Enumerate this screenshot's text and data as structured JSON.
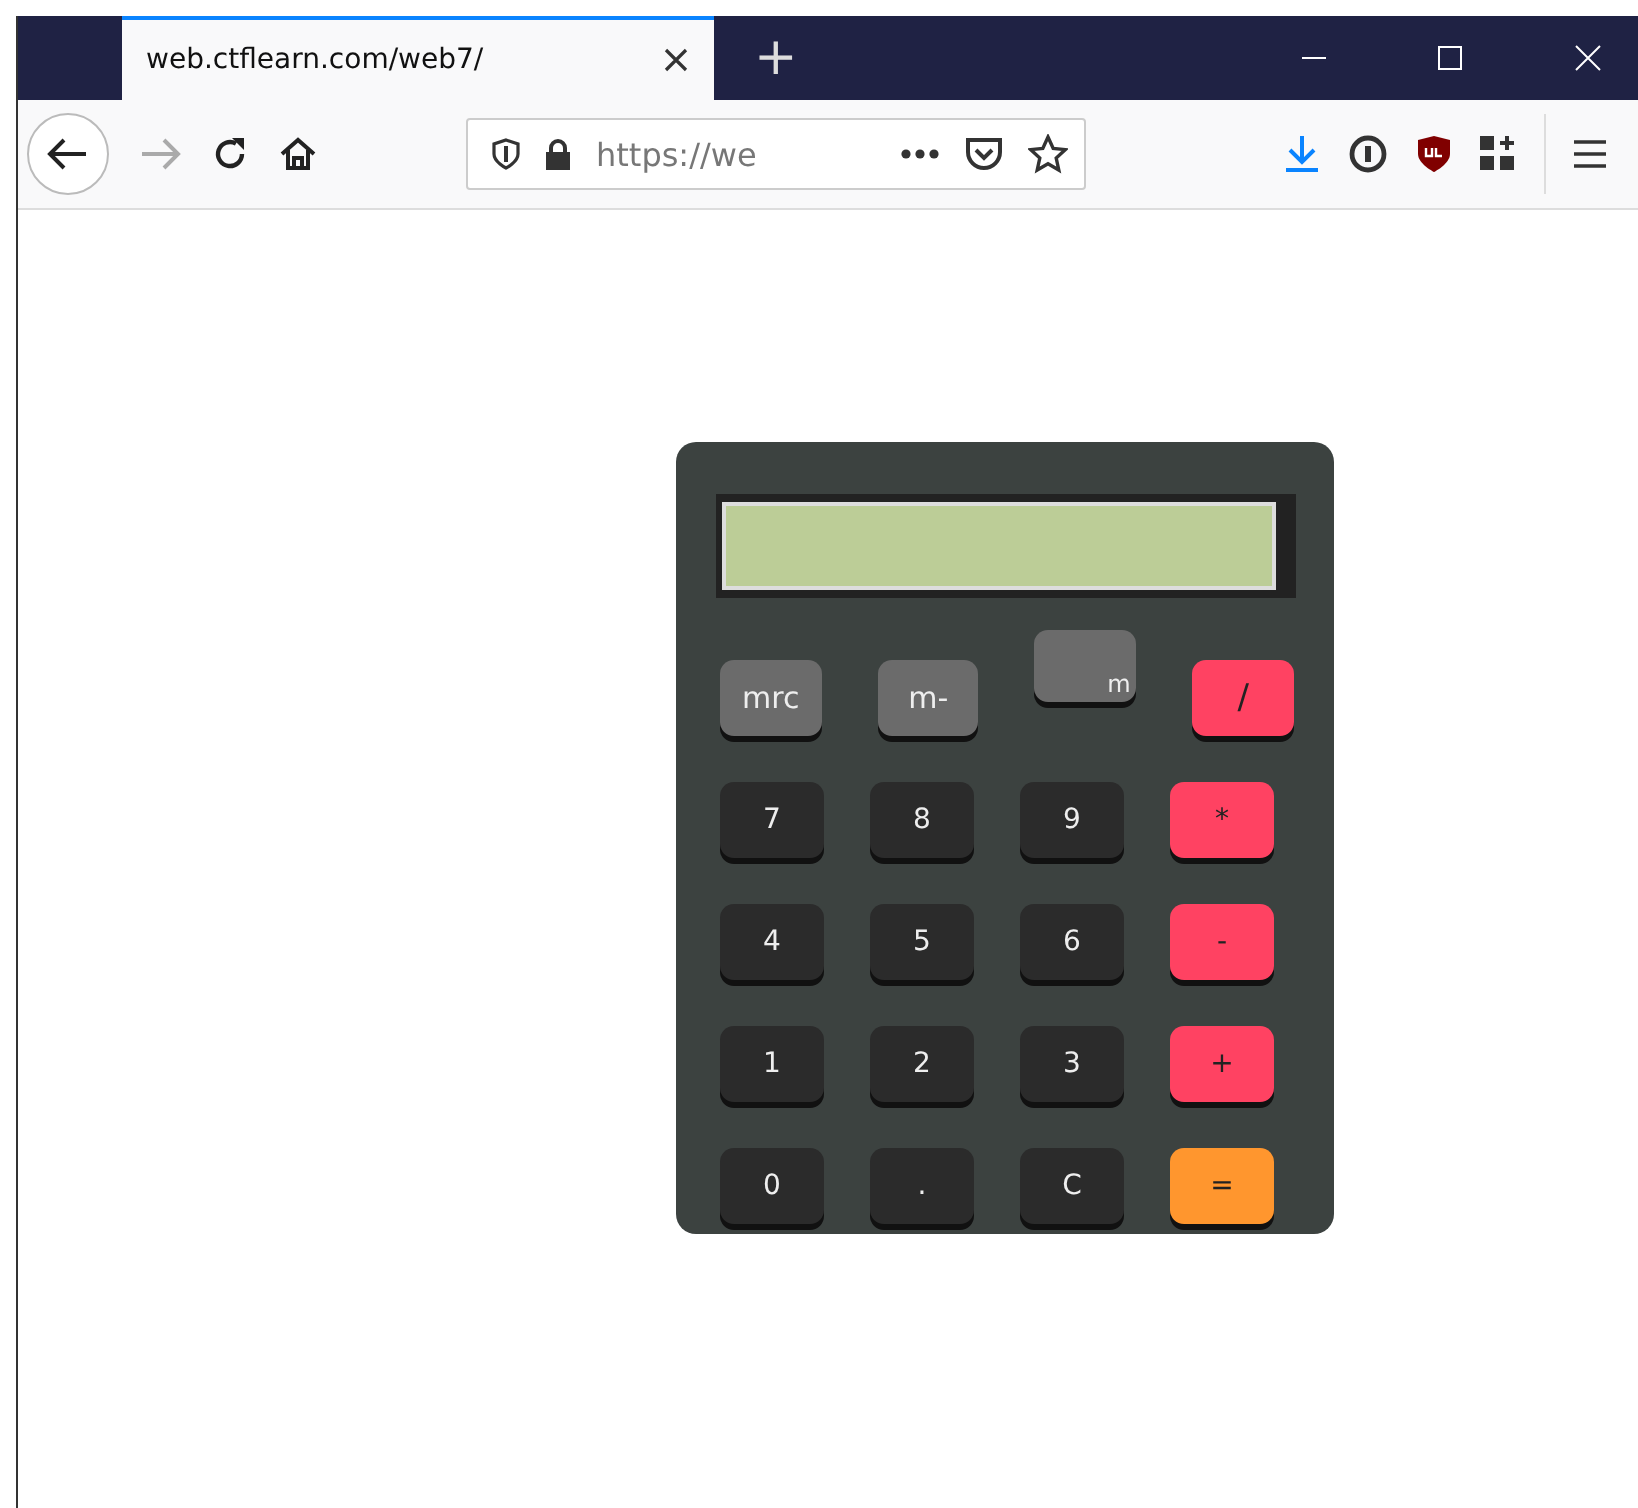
{
  "window": {
    "tab_title": "web.ctflearn.com/web7/",
    "new_tab": "+"
  },
  "toolbar": {
    "url": "https://we"
  },
  "calculator": {
    "rows": [
      [
        {
          "label": "mrc",
          "kind": "memory"
        },
        {
          "label": "m-",
          "kind": "memory"
        },
        {
          "label": "m",
          "kind": "shifted"
        },
        {
          "label": "/",
          "kind": "operator"
        }
      ],
      [
        {
          "label": "7",
          "kind": "digit"
        },
        {
          "label": "8",
          "kind": "digit"
        },
        {
          "label": "9",
          "kind": "digit"
        },
        {
          "label": "*",
          "kind": "operator"
        }
      ],
      [
        {
          "label": "4",
          "kind": "digit"
        },
        {
          "label": "5",
          "kind": "digit"
        },
        {
          "label": "6",
          "kind": "digit"
        },
        {
          "label": "-",
          "kind": "operator"
        }
      ],
      [
        {
          "label": "1",
          "kind": "digit"
        },
        {
          "label": "2",
          "kind": "digit"
        },
        {
          "label": "3",
          "kind": "digit"
        },
        {
          "label": "+",
          "kind": "operator"
        }
      ],
      [
        {
          "label": "0",
          "kind": "digit"
        },
        {
          "label": ".",
          "kind": "digit"
        },
        {
          "label": "C",
          "kind": "digit"
        },
        {
          "label": "=",
          "kind": "equals"
        }
      ]
    ]
  }
}
